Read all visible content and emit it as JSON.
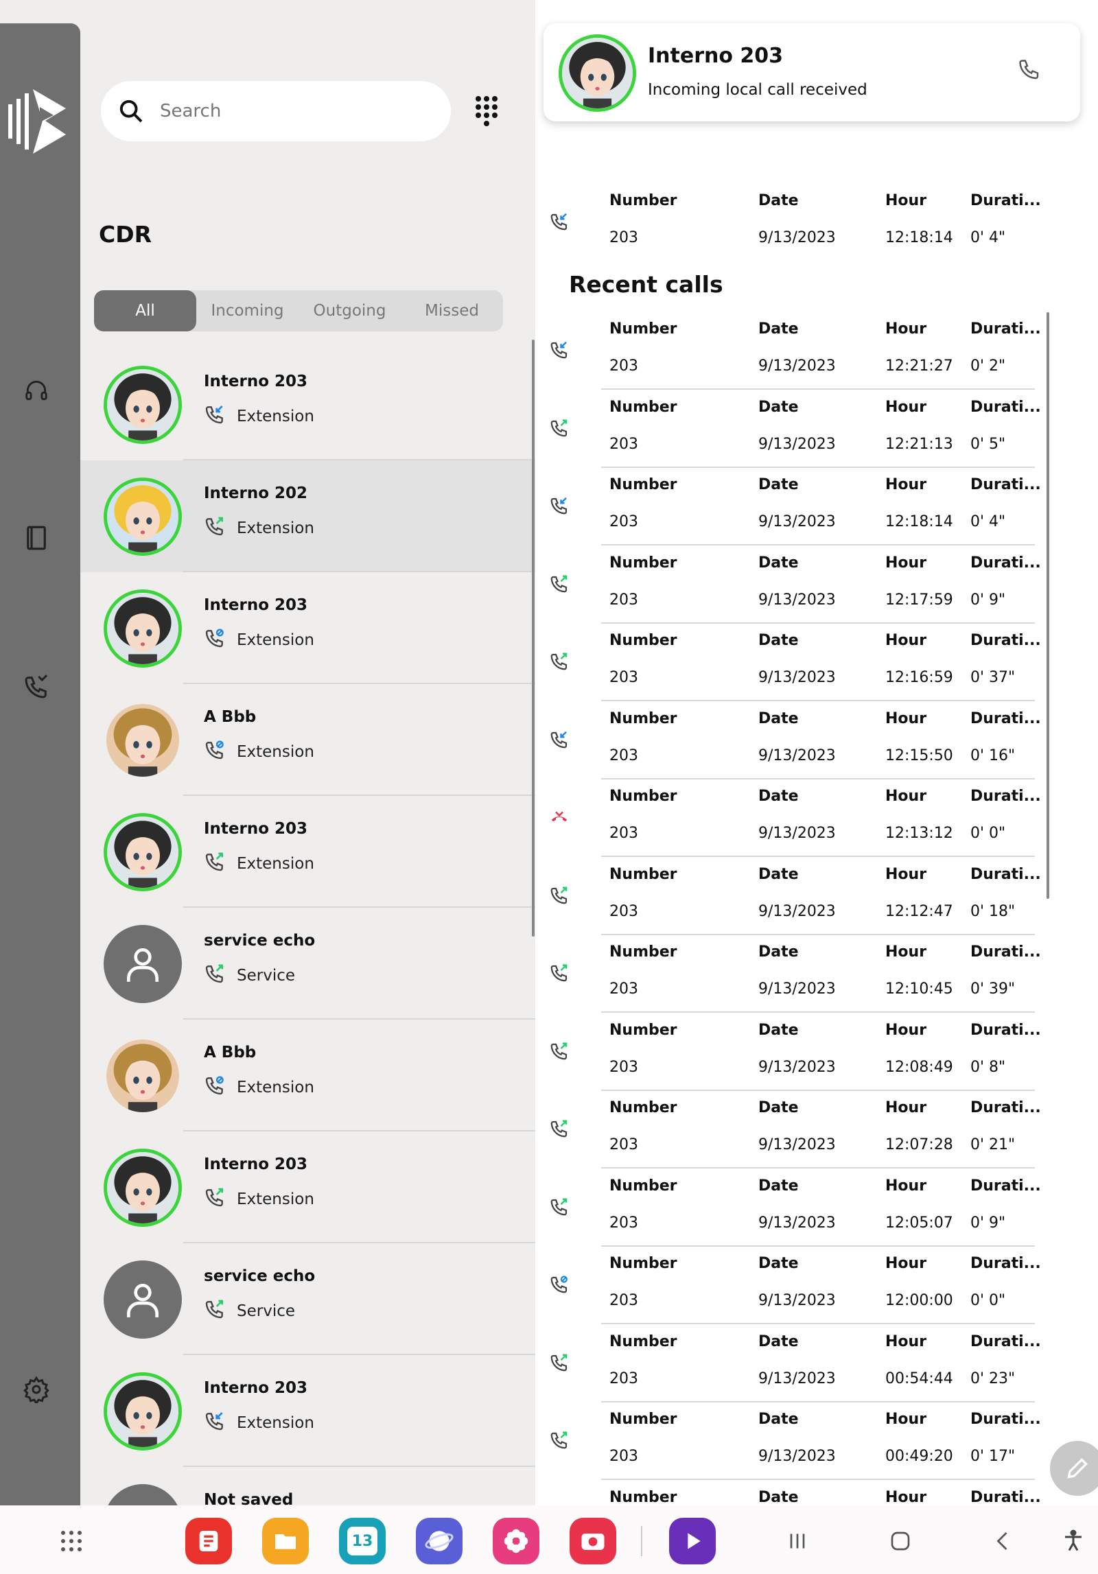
{
  "search": {
    "placeholder": "Search"
  },
  "cdr": {
    "title": "CDR",
    "filters": [
      "All",
      "Incoming",
      "Outgoing",
      "Missed"
    ],
    "active_filter": "All"
  },
  "contacts": [
    {
      "name": "Interno 203",
      "type": "Extension",
      "call": "incoming",
      "avatar": "woman-dark-hair-icon"
    },
    {
      "name": "Interno 202",
      "type": "Extension",
      "call": "outgoing",
      "avatar": "blonde-girl-icon",
      "selected": true
    },
    {
      "name": "Interno 203",
      "type": "Extension",
      "call": "other",
      "avatar": "woman-dark-hair-icon"
    },
    {
      "name": "A Bbb",
      "type": "Extension",
      "call": "other",
      "avatar": "brown-hair-girl-icon"
    },
    {
      "name": "Interno 203",
      "type": "Extension",
      "call": "outgoing",
      "avatar": "woman-dark-hair-icon"
    },
    {
      "name": "service echo",
      "type": "Service",
      "call": "outgoing",
      "avatar": "person-icon"
    },
    {
      "name": "A Bbb",
      "type": "Extension",
      "call": "other",
      "avatar": "brown-hair-girl-icon"
    },
    {
      "name": "Interno 203",
      "type": "Extension",
      "call": "outgoing",
      "avatar": "woman-dark-hair-icon"
    },
    {
      "name": "service echo",
      "type": "Service",
      "call": "outgoing",
      "avatar": "person-icon"
    },
    {
      "name": "Interno 203",
      "type": "Extension",
      "call": "incoming",
      "avatar": "woman-dark-hair-icon"
    },
    {
      "name": "Not saved",
      "type": "",
      "call": "",
      "avatar": "person-icon"
    }
  ],
  "notification": {
    "title": "Interno 203",
    "subtitle": "Incoming local call received"
  },
  "labels": {
    "number": "Number",
    "date": "Date",
    "hour": "Hour",
    "duration": "Durati..."
  },
  "current_call": {
    "number": "203",
    "date": "9/13/2023",
    "hour": "12:18:14",
    "duration": "0' 4\"",
    "call": "incoming"
  },
  "recent_title": "Recent calls",
  "recent_calls": [
    {
      "number": "203",
      "date": "9/13/2023",
      "hour": "12:21:27",
      "duration": "0' 2\"",
      "call": "incoming"
    },
    {
      "number": "203",
      "date": "9/13/2023",
      "hour": "12:21:13",
      "duration": "0' 5\"",
      "call": "outgoing"
    },
    {
      "number": "203",
      "date": "9/13/2023",
      "hour": "12:18:14",
      "duration": "0' 4\"",
      "call": "incoming"
    },
    {
      "number": "203",
      "date": "9/13/2023",
      "hour": "12:17:59",
      "duration": "0' 9\"",
      "call": "outgoing"
    },
    {
      "number": "203",
      "date": "9/13/2023",
      "hour": "12:16:59",
      "duration": "0' 37\"",
      "call": "outgoing"
    },
    {
      "number": "203",
      "date": "9/13/2023",
      "hour": "12:15:50",
      "duration": "0' 16\"",
      "call": "incoming"
    },
    {
      "number": "203",
      "date": "9/13/2023",
      "hour": "12:13:12",
      "duration": "0' 0\"",
      "call": "missed"
    },
    {
      "number": "203",
      "date": "9/13/2023",
      "hour": "12:12:47",
      "duration": "0' 18\"",
      "call": "outgoing"
    },
    {
      "number": "203",
      "date": "9/13/2023",
      "hour": "12:10:45",
      "duration": "0' 39\"",
      "call": "outgoing"
    },
    {
      "number": "203",
      "date": "9/13/2023",
      "hour": "12:08:49",
      "duration": "0' 8\"",
      "call": "outgoing"
    },
    {
      "number": "203",
      "date": "9/13/2023",
      "hour": "12:07:28",
      "duration": "0' 21\"",
      "call": "outgoing"
    },
    {
      "number": "203",
      "date": "9/13/2023",
      "hour": "12:05:07",
      "duration": "0' 9\"",
      "call": "outgoing"
    },
    {
      "number": "203",
      "date": "9/13/2023",
      "hour": "12:00:00",
      "duration": "0' 0\"",
      "call": "other"
    },
    {
      "number": "203",
      "date": "9/13/2023",
      "hour": "00:54:44",
      "duration": "0' 23\"",
      "call": "outgoing"
    },
    {
      "number": "203",
      "date": "9/13/2023",
      "hour": "00:49:20",
      "duration": "0' 17\"",
      "call": "outgoing"
    },
    {
      "number": "",
      "date": "",
      "hour": "",
      "duration": "",
      "call": "outgoing"
    }
  ],
  "taskbar": {
    "calendar_day": "13",
    "apps": [
      "apps-grid-icon",
      "notes-app-icon",
      "files-app-icon",
      "calendar-app-icon",
      "browser-app-icon",
      "flower-app-icon",
      "camera-app-icon",
      "video-app-icon",
      "recents-icon",
      "home-icon",
      "back-icon",
      "accessibility-icon"
    ]
  },
  "colors": {
    "accent_green": "#3bd43a",
    "rail_gray": "#6f6f6f",
    "incoming_blue": "#1e8ae6",
    "outgoing_green": "#2ecc71",
    "missed_red": "#e8344a"
  }
}
